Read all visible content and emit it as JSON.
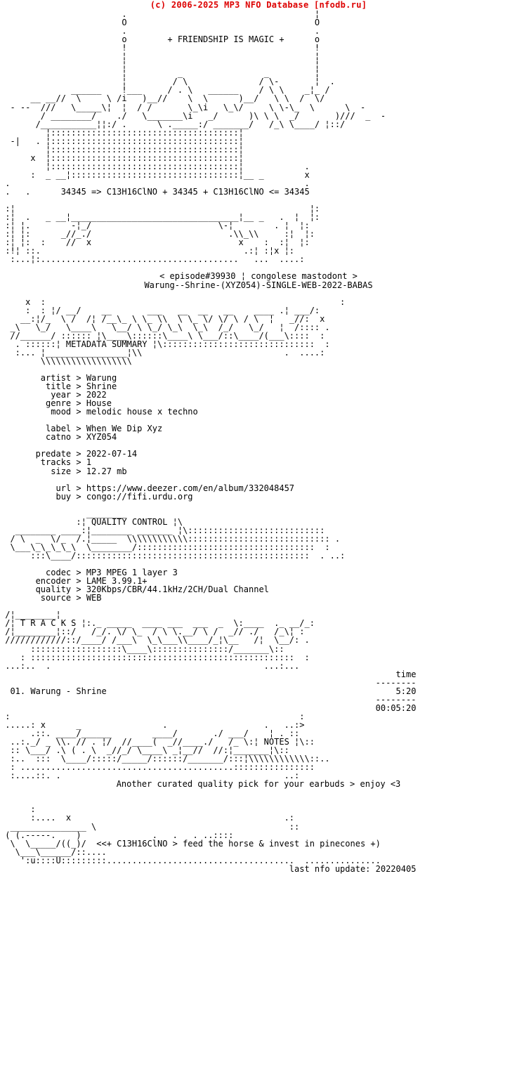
{
  "header": {
    "copyright_line": "(c) 2006-2025 MP3 NFO Database [nfodb.ru]",
    "color": "#dd0000"
  },
  "tagline": "+ FRIENDSHIP IS MAGIC +",
  "chem_line": "34345 => C13H16ClNO + 34345 + C13H16ClNO <= 34345",
  "episode_line": "< episode#39930 ¦ congolese mastodont >",
  "release_name": "Warung--Shrine-(XYZ054)-SINGLE-WEB-2022-BABAS",
  "sections": {
    "metadata_banner_label": "METADATA SUMMARY",
    "quality_banner_label": "QUALITY CONTROL",
    "tracks_banner_label": "T R A C K S",
    "notes_banner_label": "N O T E S"
  },
  "metadata": {
    "separator": ">",
    "groups": [
      [
        {
          "label": "artist",
          "value": "Warung"
        },
        {
          "label": "title",
          "value": "Shrine"
        },
        {
          "label": "year",
          "value": "2022"
        },
        {
          "label": "genre",
          "value": "House"
        },
        {
          "label": "mood",
          "value": "melodic house x techno"
        }
      ],
      [
        {
          "label": "label",
          "value": "When We Dip Xyz"
        },
        {
          "label": "catno",
          "value": "XYZ054"
        }
      ],
      [
        {
          "label": "predate",
          "value": "2022-07-14"
        },
        {
          "label": "tracks",
          "value": "1"
        },
        {
          "label": "size",
          "value": "12.27 mb"
        }
      ],
      [
        {
          "label": "url",
          "value": "https://www.deezer.com/en/album/332048457"
        },
        {
          "label": "buy",
          "value": "congo://fifi.urdu.org"
        }
      ]
    ]
  },
  "quality": {
    "separator": ">",
    "rows": [
      {
        "label": "codec",
        "value": "MP3 MPEG 1 layer 3"
      },
      {
        "label": "encoder",
        "value": "LAME 3.99.1+"
      },
      {
        "label": "quality",
        "value": "320Kbps/CBR/44.1kHz/2CH/Dual Channel"
      },
      {
        "label": "source",
        "value": "WEB"
      }
    ]
  },
  "tracklist": {
    "time_header": "time",
    "rule": "--------",
    "rows": [
      {
        "num": "01.",
        "title": "Warung - Shrine",
        "time": "5:20"
      }
    ],
    "total_time": "00:05:20"
  },
  "notes": {
    "text": "Another curated quality pick for your earbuds > enjoy <3"
  },
  "footer": {
    "greet_line": "<<+ C13H16ClNO > feed the horse & invest in pinecones +)",
    "last_update_label": "last nfo update:",
    "last_update_value": "20220405"
  },
  "ascii": {
    "top_logo": "                        .                                     ¦\n                        O                                     O\n                        .                                     .\n                        o        + FRIENDSHIP IS MAGIC +      o\n                        !                                     !\n                        ¦                                     ¦\n                        ¦                                     ¦\n                        ¦          _                _         ¦\n                        ¦         / \\              / \\-       ¦  .\n              ______    !___     / . \\   ______    / \\ \\    _¦_ /\n      __ __//  \\     \\ /i   )__//    \\  \\      )__/   \\ \\  /  \\/\n  - --  ///   \\_____\\¦  ¦  / /       \\_\\i   \\_\\/     \\ \\-\\_  \\      \\  -\n        / ________/    ./   \\_______\\i   _/      )\\ \\ \\  _/       )///  _  -\n       /___________¦¦:/ .      \\ ._____:/ _______/   /_\\ \\____/ ¦::/\n",
    "top_box": "         ¦:::::::::::::::::::::::::::::::::::::¦\n  -|   . ¦:::::::::::::::::::::::::::::::::::::¦\n         ¦:::::::::::::::::::::::::::::::::::::¦\n      x  ¦:::::::::::::::::::::::::::::::::::::¦\n         ¦:::::::::::::::::::::::::::::::::::::¦            .\n      :  _ __¦:::::::::::::::::::::::::::::::::¦__ _        x",
    "bottom_box": " .                                                          .\n .   .      34345 => C13H16ClNO + 34345 + C13H16ClNO <= 34345\n\n :¦                                                          ¦:\n :¦  .   _ __¦_________________________________¦__ _   .  ¦  ¦:\n :¦ ¦.        -¦_/                         \\-¦        . ¦  ¦:\n :¦ ¦:      _//_./                           .\\\\_\\\\     :¦  ¦:\n :¦ ¦:  :    //  x                             x    :  :¦  ¦:\n :!¦ ::.                                        .:¦ :¦x ¦:\n  :...¦:.......................................   ...  ....:",
    "metadata_banner": "     x  :                                                          :\n     :  : ¦/ __/    __       ___   __  __   __    ____ .¦ ___/:\n    __:¦/_  \\ /  /¦ /__\\_ \\ \\_ \\\\  \\ \\_ \\/ \\/ \\ / \\  ¦   _//:  x\n  _\\   \\_/   \\____\\   \\__/ \\ \\_/ \\_\\  \\_\\  /_/   \\_/   ¦  /:::: .\n  //______/ :::::: ¦\\____\\::::::\\____\\ \\___/::\\____/(___\\::::  :\n   . ::::::¦ METADATA SUMMARY ¦\\::::::::::::::::::::::::::::::  :\n   :... ¦________________¦\\\\                            .  ....:\n        \\\\\\\\\\\\\\\\\\\\\\\\\\\\\\\\\\\\",
    "quality_banner": "                 ________\n               :¦ QUALITY CONTROL ¦\\\n   ________ ____:¦________ _______ ¦\\:::::::::::::::::::::::::::\n  / \\  _  \\/_  /.¦_____  \\\\\\\\\\\\\\\\\\\\\\\\:::::::::::::::::::::::::::: .\n  \\___\\_\\_\\_\\_\\  \\________/:::::::::::::::::::::::::::::::::::  :\n      :::\\____/::::::::::::::::::::::::::::::::::::::::::::::  . ..:",
    "tracks_banner": " /¦________¦\n /¦ T R A C K S ¦:._ _____  ____ ___  ___  _  \\:____  ._ __/_:\n /¦________¦::/   /_/. \\/ \\_  / \\ \\.__/ \\ /  _// ./   /_\\¦ :\n ////////////::/____/ /___\\  \\_\\___\\\\____/_¦\\__   /¦  \\__/: .\n      ::::::::::::::::::\\____\\:::::::::::::::/_______\\::\n    : ::::::::::::::::::::::::::::::::::::::::::::::::::::  :\n ...:..  .                                          ...:...",
    "notes_banner": " :                                                         :\n .....: x      _                .                   .   ..:>\n      .::. ____/______        ____/       ./ ___/    ¦ . ::\n  ..:._/ _ \\\\. // . ¦/  //____(  _//____./   /_ \\:¦ NOTES ¦\\::\n  :: \\___/ .\\ ( . \\  _//_/ \\____\\ _¦__//  //:¦_______¦\\::\n  :..  :::  \\____/:::::/_____/::::::/_______/:::¦\\\\\\\\\\\\\\\\\\\\\\\\::..\n  : ..........................................::::::::::::::::\n  :....::. .                                            ..:",
    "footer_art": "      :\n      :....  x                                          .:\n  _______________ \\                                      ::\n ( (.-----.    )              .   .   . ..::::\n  \\  \\_____/((_)/  <<+ C13H16ClNO > feed the horse & invest in pinecones +)\n   \\___\\______/::....\n    ':u::::U:::::::::.....................................  ..............."
  }
}
